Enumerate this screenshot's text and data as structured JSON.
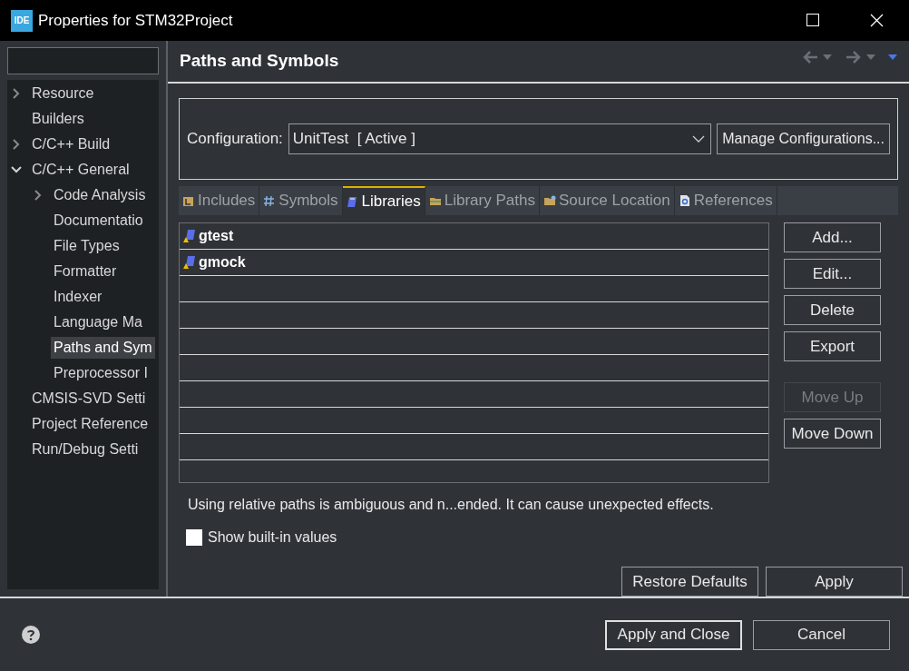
{
  "window": {
    "title": "Properties for STM32Project",
    "app_badge": "IDE"
  },
  "tree": [
    {
      "label": "Resource",
      "expanded": false,
      "selected": false
    },
    {
      "label": "Builders",
      "selected": false
    },
    {
      "label": "C/C++ Build",
      "expanded": false,
      "selected": false
    },
    {
      "label": "C/C++ General",
      "expanded": true,
      "selected": false,
      "children": [
        {
          "label": "Code Analysis",
          "expanded": false,
          "selected": false
        },
        {
          "label": "Documentatio",
          "selected": false
        },
        {
          "label": "File Types",
          "selected": false
        },
        {
          "label": "Formatter",
          "selected": false
        },
        {
          "label": "Indexer",
          "selected": false
        },
        {
          "label": "Language Ma",
          "selected": false
        },
        {
          "label": "Paths and Sym",
          "selected": true
        },
        {
          "label": "Preprocessor I",
          "selected": false
        }
      ]
    },
    {
      "label": "CMSIS-SVD Setti",
      "selected": false
    },
    {
      "label": "Project Reference",
      "selected": false
    },
    {
      "label": "Run/Debug Setti",
      "selected": false
    }
  ],
  "page": {
    "title": "Paths and Symbols",
    "configuration": {
      "label": "Configuration:",
      "value": "UnitTest  [ Active ]",
      "manage_button": "Manage Configurations..."
    },
    "tabs": [
      {
        "label": "Includes",
        "kind": "includes",
        "selected": false
      },
      {
        "label": "Symbols",
        "kind": "symbols",
        "selected": false
      },
      {
        "label": "Libraries",
        "kind": "libraries",
        "selected": true
      },
      {
        "label": "Library Paths",
        "kind": "folder",
        "selected": false
      },
      {
        "label": "Source Location",
        "kind": "source",
        "selected": false
      },
      {
        "label": "References",
        "kind": "references",
        "selected": false
      }
    ],
    "libraries": [
      {
        "name": "gtest"
      },
      {
        "name": "gmock"
      }
    ],
    "side_buttons": [
      {
        "label": "Add...",
        "disabled": false
      },
      {
        "label": "Edit...",
        "disabled": false
      },
      {
        "label": "Delete",
        "disabled": false
      },
      {
        "label": "Export",
        "disabled": false
      },
      {
        "label": "Move Up",
        "disabled": true
      },
      {
        "label": "Move Down",
        "disabled": false
      }
    ],
    "note": "Using relative paths is ambiguous and n...ended. It can cause unexpected effects.",
    "show_builtin": {
      "label": "Show built-in values",
      "checked": false
    },
    "restore_button": "Restore Defaults",
    "apply_button": "Apply"
  },
  "footer": {
    "apply_close_button": "Apply and Close",
    "cancel_button": "Cancel"
  }
}
